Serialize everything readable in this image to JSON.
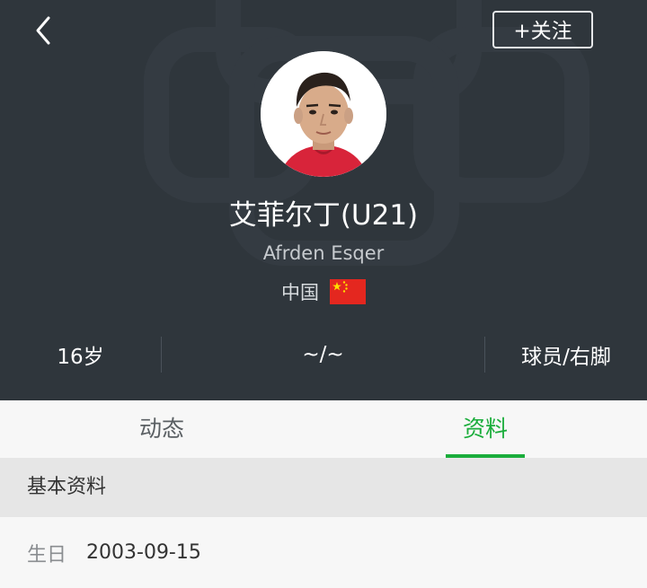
{
  "header": {
    "follow_label": "+关注",
    "player_name": "艾菲尔丁(U21)",
    "player_name_en": "Afrden Esqer",
    "country": "中国",
    "stats": {
      "age": "16岁",
      "height_weight": "~/~",
      "role": "球员/右脚"
    }
  },
  "tabs": [
    {
      "label": "动态",
      "active": false
    },
    {
      "label": "资料",
      "active": true
    }
  ],
  "section": {
    "title": "基本资料",
    "rows": [
      {
        "label": "生日",
        "value": "2003-09-15"
      }
    ]
  },
  "colors": {
    "header_bg": "#2f363c",
    "accent": "#1aad3b"
  }
}
